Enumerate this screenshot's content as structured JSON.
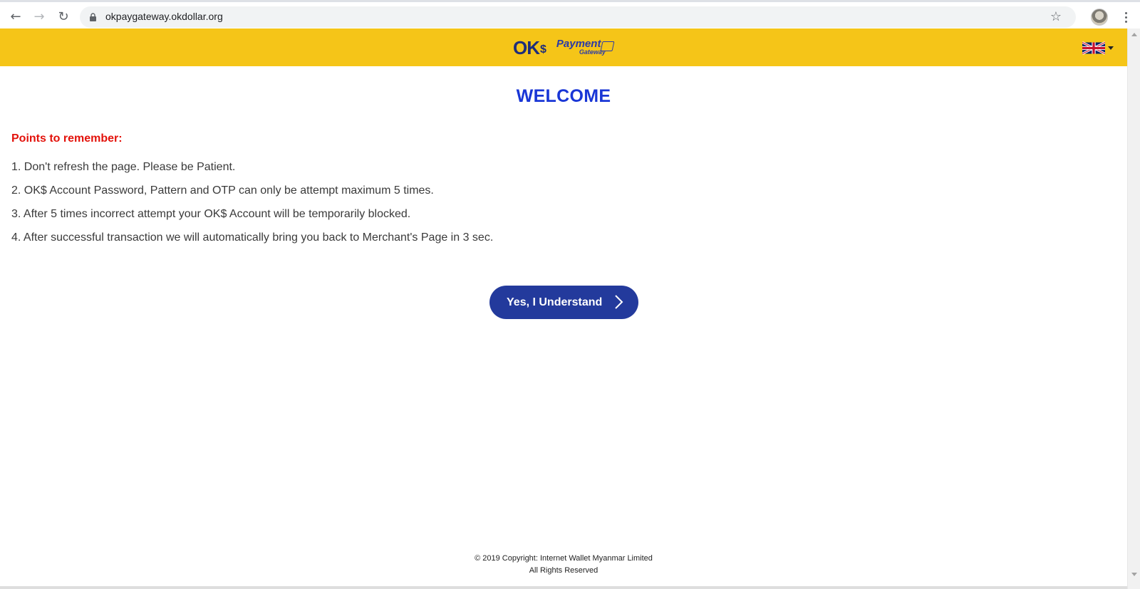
{
  "browser": {
    "url": "okpaygateway.okdollar.org",
    "back_icon": "arrow-left-icon",
    "forward_icon": "arrow-right-icon",
    "reload_icon": "reload-icon",
    "lock_icon": "lock-icon",
    "bookmark_icon": "star-icon",
    "menu_icon": "kebab-menu-icon"
  },
  "header": {
    "logo_ok": "OK",
    "logo_dollar": "$",
    "logo_payment": "Payment",
    "logo_gateway": "Gateway",
    "language_flag": "uk-flag-icon",
    "background_color": "#f5c518"
  },
  "main": {
    "title": "WELCOME",
    "points_heading": "Points to remember:",
    "points": [
      "1. Don't refresh the page. Please be Patient.",
      "2. OK$ Account Password, Pattern and OTP can only be attempt maximum 5 times.",
      "3. After 5 times incorrect attempt your OK$ Account will be temporarily blocked.",
      "4. After successful transaction we will automatically bring you back to Merchant's Page in 3 sec."
    ],
    "button_label": "Yes, I Understand",
    "button_color": "#233a9c",
    "title_color": "#1936d6",
    "heading_color": "#e3120b"
  },
  "footer": {
    "copyright": "© 2019 Copyright: Internet Wallet Myanmar Limited",
    "rights": "All Rights Reserved"
  }
}
